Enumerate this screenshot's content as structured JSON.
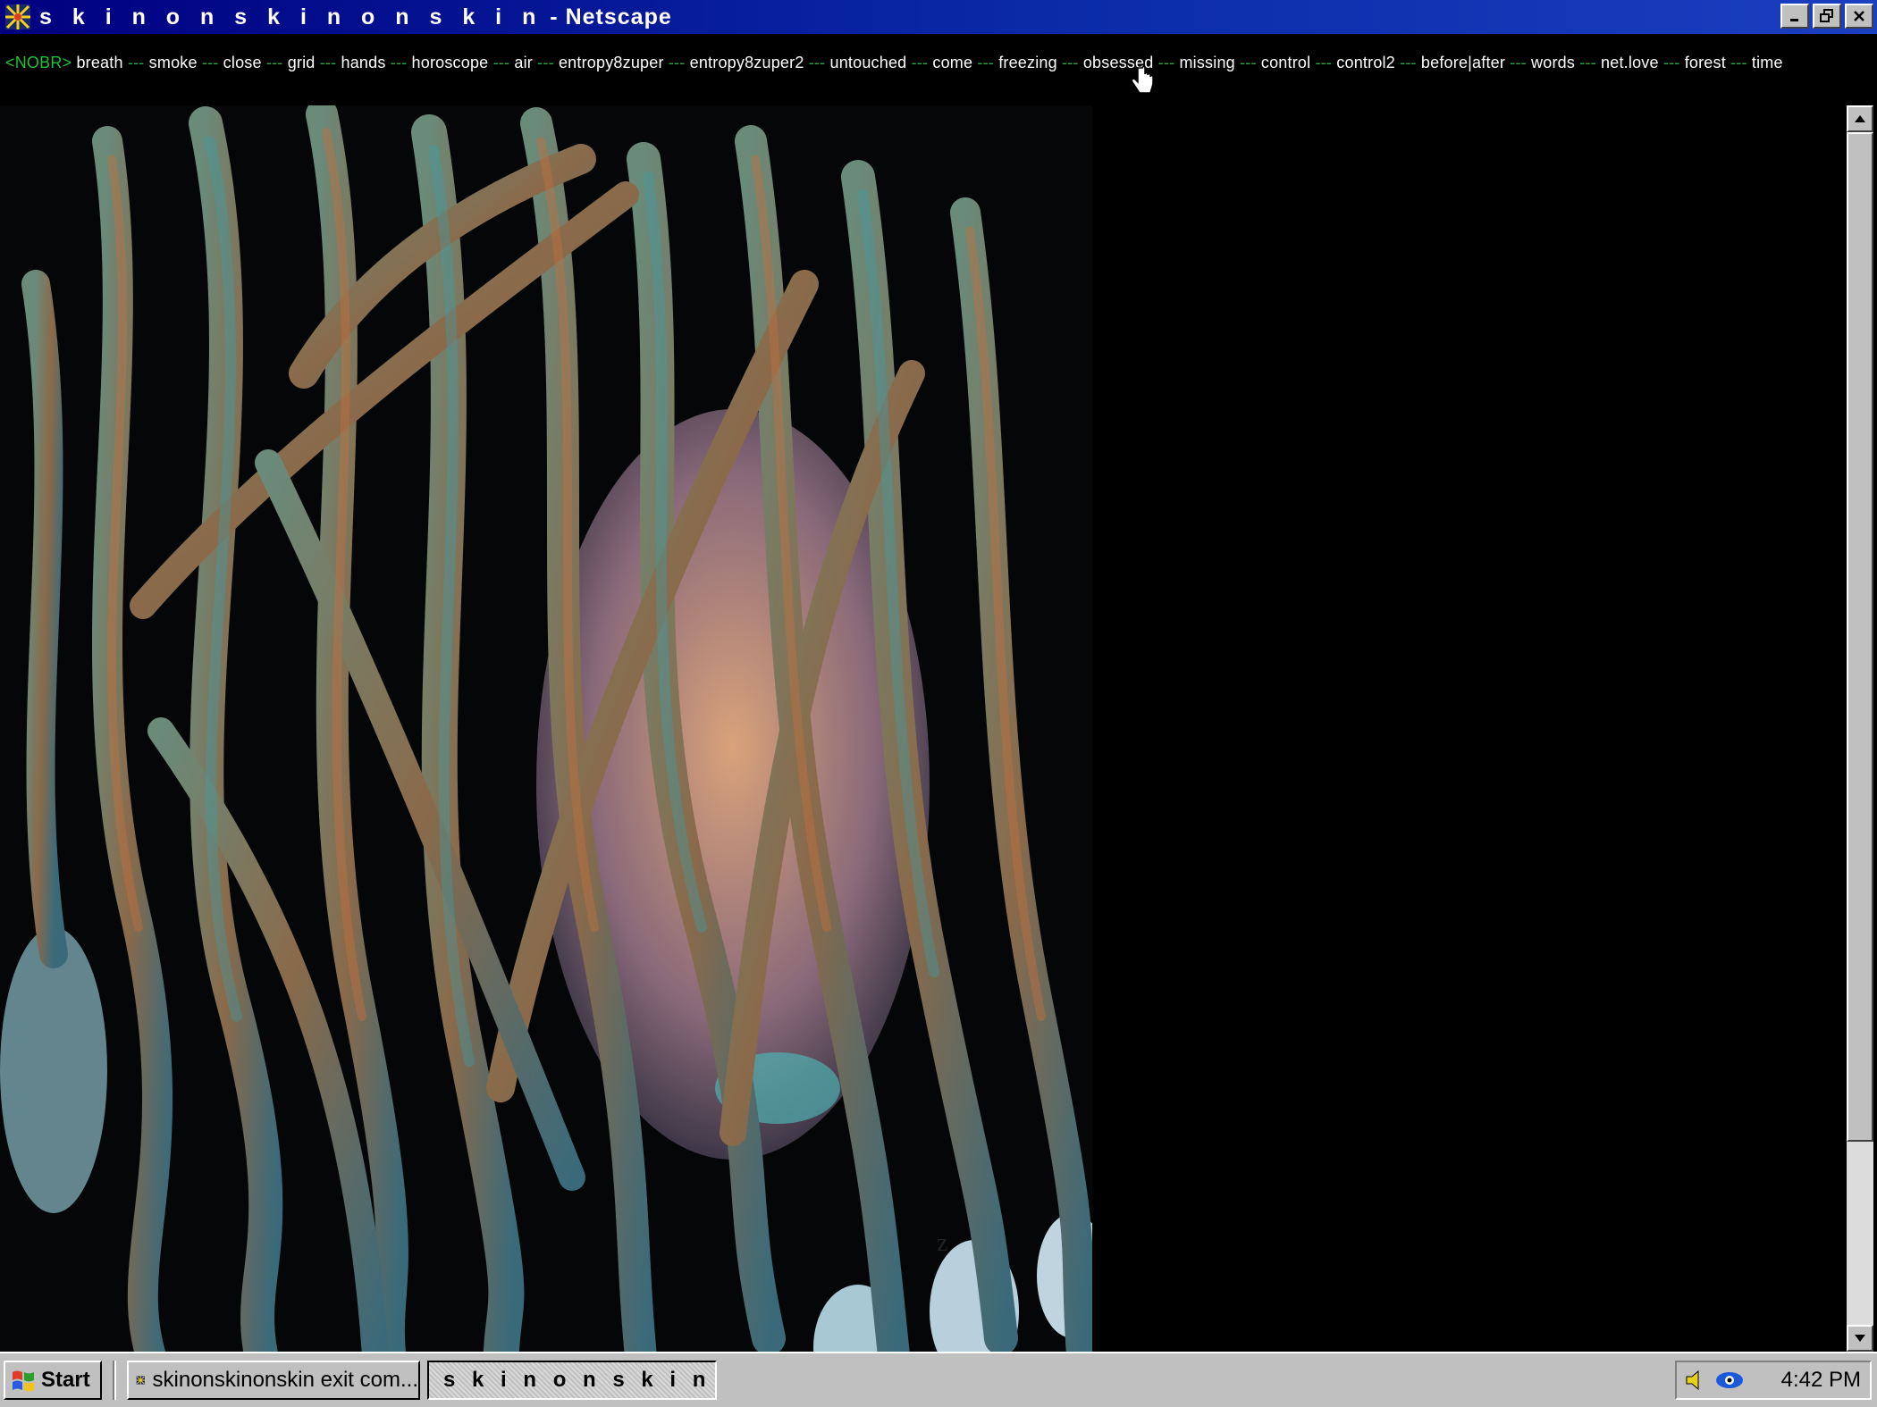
{
  "window": {
    "title_spaced": "s k i n o n s k i n o n s k i n",
    "title_app": " - Netscape",
    "controls": [
      "minimize",
      "restore",
      "close"
    ]
  },
  "page": {
    "nobr_tag": "<NOBR>",
    "separator": "---",
    "nav_links": [
      "breath",
      "smoke",
      "close",
      "grid",
      "hands",
      "horoscope",
      "air",
      "entropy8zuper",
      "entropy8zuper2",
      "untouched",
      "come",
      "freezing",
      "obsessed",
      "missing",
      "control",
      "control2",
      "before|after",
      "words",
      "net.love",
      "forest",
      "time"
    ],
    "photo_overlay_letter": "z"
  },
  "taskbar": {
    "start_label": "Start",
    "tasks": [
      {
        "label": "skinonskinonskin exit com...",
        "active": false
      },
      {
        "label": "s k i n o n s k i n o n ...",
        "active": true
      }
    ],
    "clock": "4:42 PM"
  },
  "colors": {
    "titlebar": "#000080",
    "nav_separator": "#2ca84a",
    "nobr_tag": "#1fbf3f",
    "page_bg": "#000000",
    "chrome": "#c0c0c0"
  }
}
